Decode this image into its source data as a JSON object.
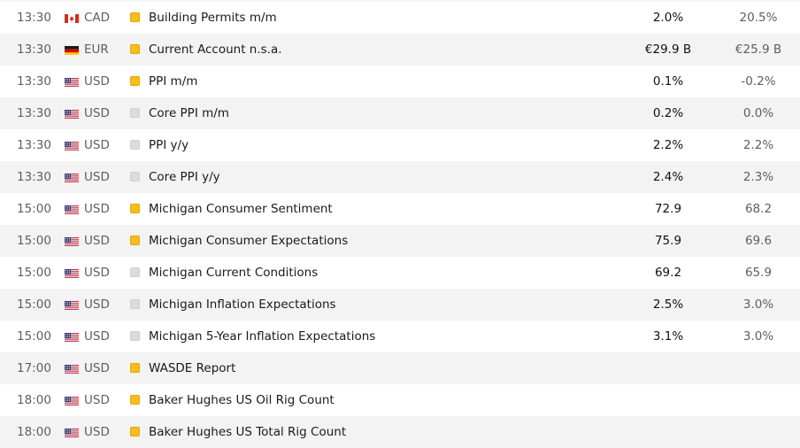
{
  "colors": {
    "high_importance": "#f5be1f",
    "low_importance": "#dcdcdc",
    "row_alt": "#f3f3f3",
    "row": "#ffffff"
  },
  "events": [
    {
      "time": "13:30",
      "flag": "flag-canada-icon",
      "currency": "CAD",
      "importance": "high",
      "name": "Building Permits m/m",
      "actual": "2.0%",
      "previous": "20.5%"
    },
    {
      "time": "13:30",
      "flag": "flag-germany-icon",
      "currency": "EUR",
      "importance": "high",
      "name": "Current Account n.s.a.",
      "actual": "€29.9 B",
      "previous": "€25.9 B"
    },
    {
      "time": "13:30",
      "flag": "flag-usa-icon",
      "currency": "USD",
      "importance": "high",
      "name": "PPI m/m",
      "actual": "0.1%",
      "previous": "-0.2%"
    },
    {
      "time": "13:30",
      "flag": "flag-usa-icon",
      "currency": "USD",
      "importance": "low",
      "name": "Core PPI m/m",
      "actual": "0.2%",
      "previous": "0.0%"
    },
    {
      "time": "13:30",
      "flag": "flag-usa-icon",
      "currency": "USD",
      "importance": "low",
      "name": "PPI y/y",
      "actual": "2.2%",
      "previous": "2.2%"
    },
    {
      "time": "13:30",
      "flag": "flag-usa-icon",
      "currency": "USD",
      "importance": "low",
      "name": "Core PPI y/y",
      "actual": "2.4%",
      "previous": "2.3%"
    },
    {
      "time": "15:00",
      "flag": "flag-usa-icon",
      "currency": "USD",
      "importance": "high",
      "name": "Michigan Consumer Sentiment",
      "actual": "72.9",
      "previous": "68.2"
    },
    {
      "time": "15:00",
      "flag": "flag-usa-icon",
      "currency": "USD",
      "importance": "high",
      "name": "Michigan Consumer Expectations",
      "actual": "75.9",
      "previous": "69.6"
    },
    {
      "time": "15:00",
      "flag": "flag-usa-icon",
      "currency": "USD",
      "importance": "low",
      "name": "Michigan Current Conditions",
      "actual": "69.2",
      "previous": "65.9"
    },
    {
      "time": "15:00",
      "flag": "flag-usa-icon",
      "currency": "USD",
      "importance": "low",
      "name": "Michigan Inflation Expectations",
      "actual": "2.5%",
      "previous": "3.0%"
    },
    {
      "time": "15:00",
      "flag": "flag-usa-icon",
      "currency": "USD",
      "importance": "low",
      "name": "Michigan 5-Year Inflation Expectations",
      "actual": "3.1%",
      "previous": "3.0%"
    },
    {
      "time": "17:00",
      "flag": "flag-usa-icon",
      "currency": "USD",
      "importance": "high",
      "name": "WASDE Report",
      "actual": "",
      "previous": ""
    },
    {
      "time": "18:00",
      "flag": "flag-usa-icon",
      "currency": "USD",
      "importance": "high",
      "name": "Baker Hughes US Oil Rig Count",
      "actual": "",
      "previous": ""
    },
    {
      "time": "18:00",
      "flag": "flag-usa-icon",
      "currency": "USD",
      "importance": "high",
      "name": "Baker Hughes US Total Rig Count",
      "actual": "",
      "previous": ""
    }
  ]
}
